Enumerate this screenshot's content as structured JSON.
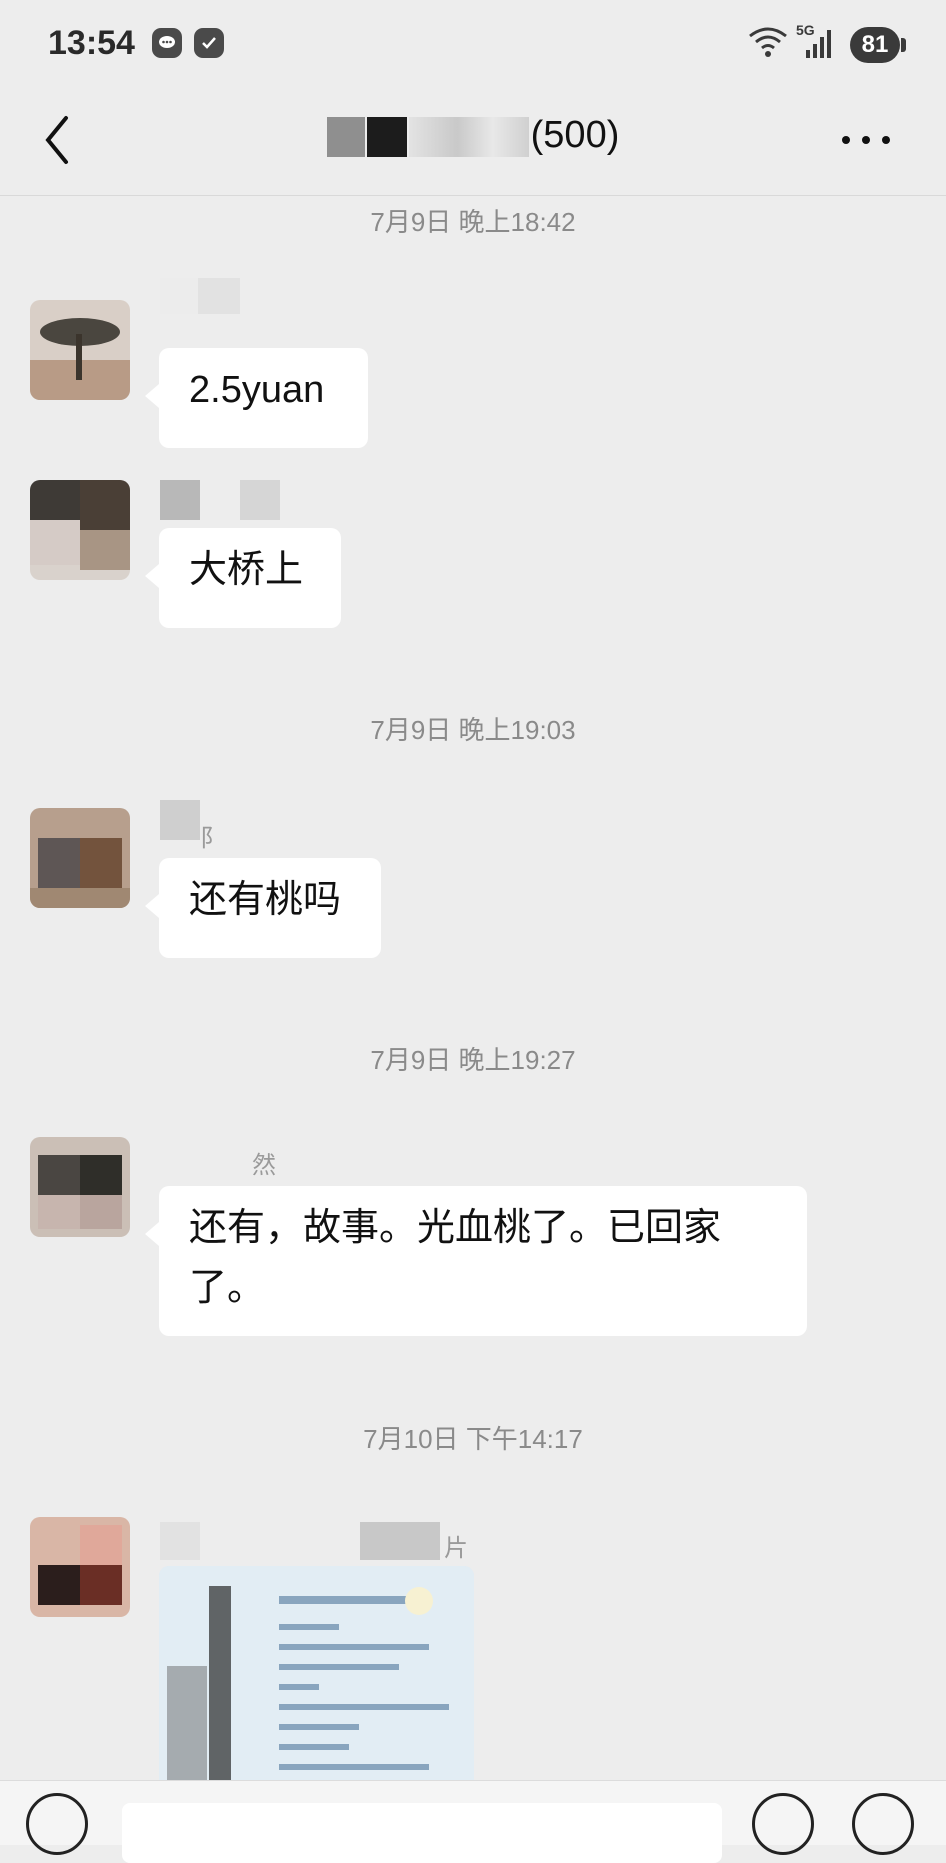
{
  "status_bar": {
    "time": "13:54",
    "network": "5G",
    "battery": "81"
  },
  "header": {
    "title": "(500)"
  },
  "messages": [
    {
      "timestamp": "7月9日 晚上18:42",
      "text": "2.5yuan"
    },
    {
      "text": "大桥上"
    },
    {
      "timestamp": "7月9日 晚上19:03",
      "sender_fragment": "阝",
      "text": "还有桃吗"
    },
    {
      "timestamp": "7月9日 晚上19:27",
      "sender_fragment": "然",
      "text": "还有，故事。光血桃了。已回家了。"
    },
    {
      "timestamp": "7月10日 下午14:17",
      "sender_fragment": "片",
      "type": "image"
    }
  ],
  "colors": {
    "background": "#ededed",
    "bubble": "#ffffff",
    "timestamp": "#8a8a8a"
  }
}
